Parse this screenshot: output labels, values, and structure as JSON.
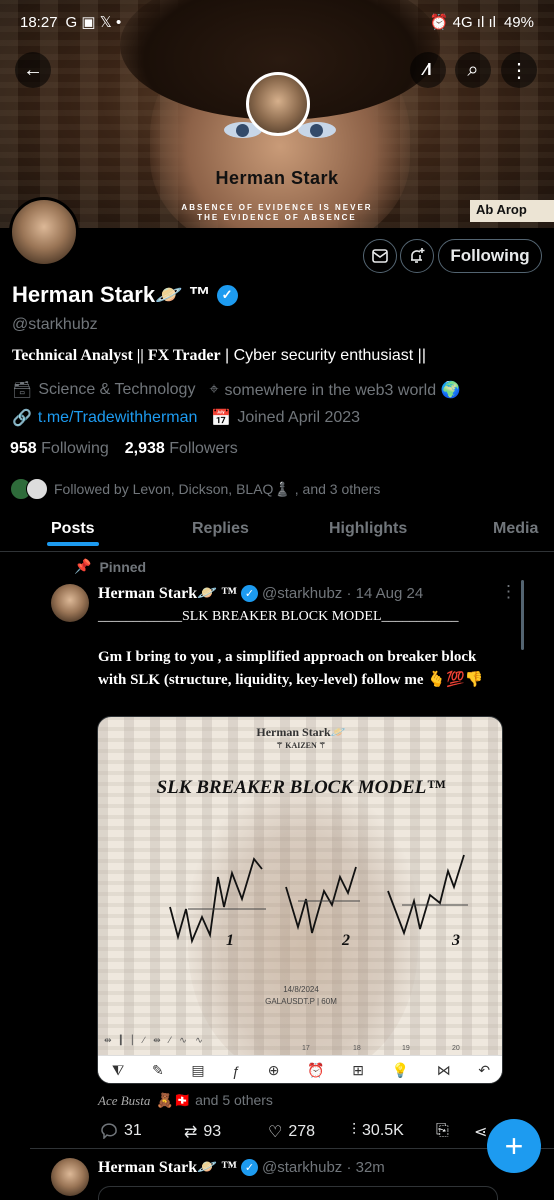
{
  "status_bar": {
    "time": "18:27",
    "left_icons": "G ▣ 𝕏 •",
    "right_icons": "⏰ 4G ıl ıl",
    "battery": "49%"
  },
  "banner": {
    "name": "Herman Stark",
    "tagline": "ABSENCE OF EVIDENCE IS NEVER THE EVIDENCE OF ABSENCE",
    "corner_text": "Ab Arop"
  },
  "header_buttons": {
    "back": "←",
    "grok": "⁄l",
    "search": "⌕",
    "more": "⋮"
  },
  "profile": {
    "display_name": "Herman Stark🪐 ™",
    "handle": "@starkhubz",
    "bio_bold": "Technical Analyst || FX Trader",
    "bio_rest": " | Cyber security enthusiast ||",
    "category": "Science & Technology",
    "location": "somewhere in the web3 world 🌍",
    "link": "t.me/Tradewithherman",
    "joined": "Joined April 2023",
    "following_count": "958",
    "following_label": "Following",
    "followers_count": "2,938",
    "followers_label": "Followers",
    "followed_by": "Followed by Levon, Dickson, BLAQ♟️ , and 3 others"
  },
  "follow_button": "Following",
  "tabs": [
    "Posts",
    "Replies",
    "Highlights",
    "Media"
  ],
  "pinned_tweet": {
    "pinned_label": "Pinned",
    "name": "Herman Stark🪐 ™",
    "handle_date": "@starkhubz · 14 Aug 24",
    "line1": "____________SLK BREAKER BLOCK MODEL___________",
    "body": "Gm I bring to you , a simplified approach on  breaker block with SLK (structure, liquidity, key-level) follow me 🫰💯👎",
    "media": {
      "name": "Herman Stark🪐",
      "kaizen": "⚚ KAIZEN ⚚",
      "title": "SLK BREAKER  BLOCK MODEL™",
      "labels": [
        "1",
        "2",
        "3"
      ],
      "date": "14/8/2024",
      "pair": "GALAUSDT.P | 60M",
      "axis": [
        "17",
        "18",
        "19",
        "20"
      ]
    },
    "reactors_sig": "Ace Busta",
    "reactors_text": "🧸🇨🇭 and 5 others",
    "replies": "31",
    "reposts": "93",
    "likes": "278",
    "views": "30.5K"
  },
  "next_tweet": {
    "name": "Herman Stark🪐 ™",
    "handle_date": "@starkhubz · 32m"
  },
  "fab": "+"
}
